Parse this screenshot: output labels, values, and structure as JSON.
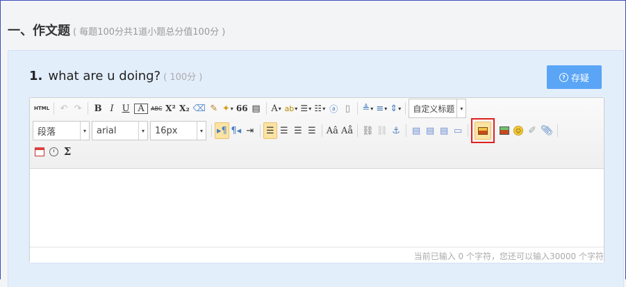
{
  "section": {
    "title": "一、作文题",
    "meta": "( 每题100分共1道小题总分值100分 )"
  },
  "question": {
    "number": "1.",
    "text": "what are u doing?",
    "points": "( 100分 )",
    "doubt_label": "存疑"
  },
  "toolbar": {
    "html_label": "HTML",
    "bold": "B",
    "italic": "I",
    "underline": "U",
    "frame_text": "A",
    "strikethrough": "ABC",
    "superscript": "X²",
    "subscript": "X₂",
    "quote": "66",
    "font_color": "A",
    "heading_select": "自定义标题",
    "paragraph_select": "段落",
    "font_family_select": "arial",
    "font_size_select": "16px",
    "sigma": "Σ"
  },
  "status": {
    "text": "当前已输入 0 个字符，您还可以输入30000 个字符"
  },
  "colors": {
    "accent": "#5aa5f6",
    "panel_bg": "#e3eefb",
    "highlight": "#e02020"
  }
}
